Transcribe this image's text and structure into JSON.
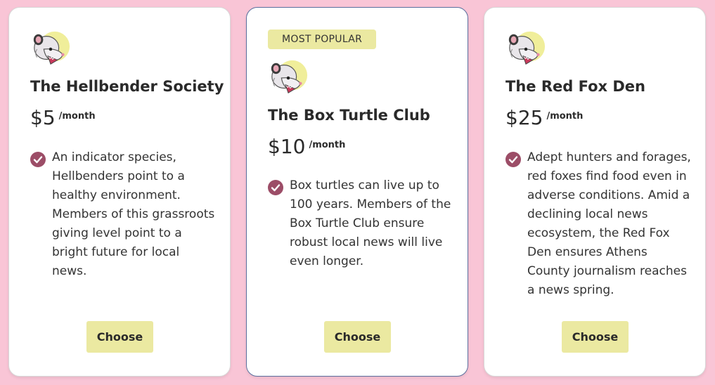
{
  "badge_label": "MOST POPULAR",
  "cards": [
    {
      "title": "The Hellbender Society",
      "price": "$5",
      "period": "/month",
      "description": "An indicator species, Hellbenders point to a healthy environment. Members of this grassroots giving level point to a bright future for local news.",
      "button": "Choose"
    },
    {
      "title": "The Box Turtle Club",
      "price": "$10",
      "period": "/month",
      "description": "Box turtles can live up to 100 years. Members of the Box Turtle Club ensure robust local news will live even longer.",
      "button": "Choose"
    },
    {
      "title": "The Red Fox Den",
      "price": "$25",
      "period": "/month",
      "description": "Adept hunters and forages, red foxes find food even in adverse conditions. Amid a declining local news ecosystem, the Red Fox Den ensures Athens County journalism reaches a news spring.",
      "button": "Choose"
    }
  ],
  "colors": {
    "background": "#f9c5d6",
    "button": "#ebe9a1",
    "check": "#9c4d67",
    "featured_border": "#5b6f9e"
  }
}
